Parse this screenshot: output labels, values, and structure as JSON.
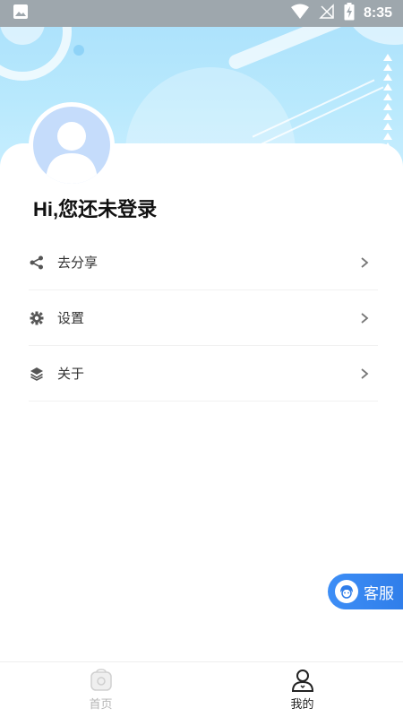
{
  "status_bar": {
    "time": "8:35",
    "icons": [
      "image-icon",
      "wifi-icon",
      "no-signal-icon",
      "battery-charging-icon"
    ]
  },
  "profile": {
    "greeting": "Hi,您还未登录",
    "avatar": "default-avatar"
  },
  "menu": {
    "items": [
      {
        "label": "去分享",
        "icon": "share-icon"
      },
      {
        "label": "设置",
        "icon": "gear-icon"
      },
      {
        "label": "关于",
        "icon": "layers-icon"
      }
    ]
  },
  "service_button": {
    "label": "客服",
    "icon": "customer-service-icon"
  },
  "tab_bar": {
    "tabs": [
      {
        "label": "首页",
        "icon": "home-icon",
        "active": false
      },
      {
        "label": "我的",
        "icon": "user-icon",
        "active": true
      }
    ]
  },
  "colors": {
    "accent": "#2f7de9",
    "banner": "#a9e0fb",
    "avatar_bg": "#c5dcfb",
    "inactive_text": "#b5b5b5"
  }
}
